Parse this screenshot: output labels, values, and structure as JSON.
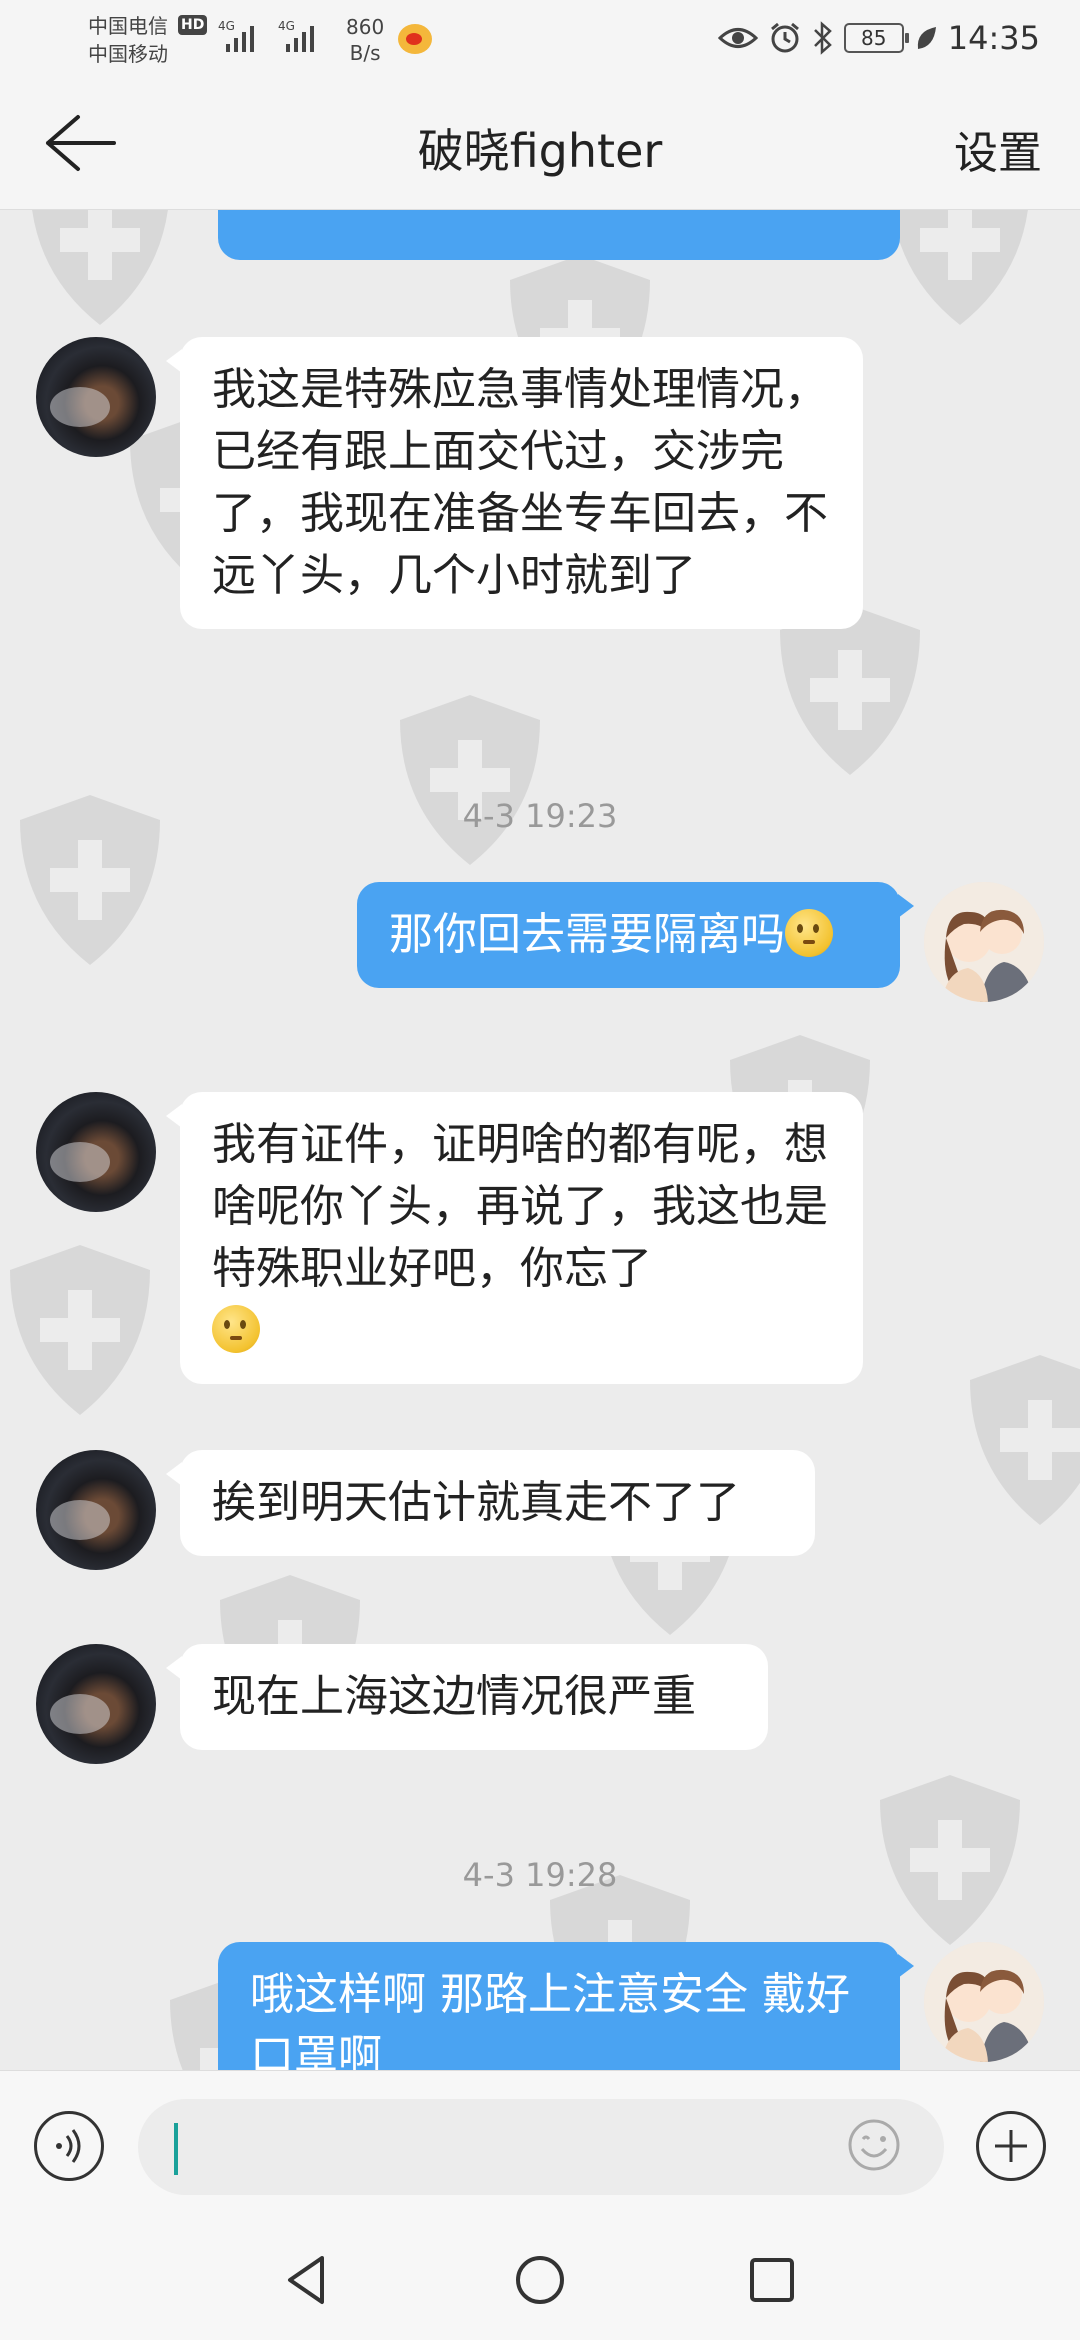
{
  "status_bar": {
    "carrier_1": "中国电信",
    "carrier_2": "中国移动",
    "hd_badge": "HD",
    "signal_1": "4G",
    "signal_2": "4G",
    "net_speed_value": "860",
    "net_speed_unit": "B/s",
    "battery": "85",
    "time": "14:35",
    "icons": [
      "weibo-icon",
      "eye-icon",
      "alarm-icon",
      "bluetooth-icon",
      "battery-icon",
      "leaf-icon"
    ]
  },
  "nav": {
    "title": "破晓fighter",
    "settings_label": "设置",
    "back_icon": "back-arrow-icon"
  },
  "messages": [
    {
      "type": "partial-right"
    },
    {
      "type": "left",
      "text": "我这是特殊应急事情处理情况，已经有跟上面交代过，交涉完了，我现在准备坐专车回去，不远丫头，几个小时就到了"
    },
    {
      "type": "time",
      "text": "4-3 19:23"
    },
    {
      "type": "right",
      "text": "那你回去需要隔离吗",
      "emoji": "thinking-emoji"
    },
    {
      "type": "left",
      "text": "我有证件，证明啥的都有呢，想啥呢你丫头，再说了，我这也是特殊职业好吧，你忘了",
      "emoji": "thinking-emoji"
    },
    {
      "type": "left",
      "text": "挨到明天估计就真走不了了"
    },
    {
      "type": "left",
      "text": "现在上海这边情况很严重"
    },
    {
      "type": "time",
      "text": "4-3 19:28"
    },
    {
      "type": "right",
      "text": "哦这样啊 那路上注意安全 戴好口罩啊"
    }
  ],
  "input_bar": {
    "placeholder": "",
    "voice_icon": "voice-icon",
    "emoji_icon": "emoji-icon",
    "plus_icon": "plus-icon"
  },
  "system_nav": [
    "back-triangle-icon",
    "home-circle-icon",
    "recents-square-icon"
  ],
  "colors": {
    "bubble_right": "#4aa3f2",
    "bubble_left": "#ffffff",
    "background": "#ececec",
    "watermark": "#c9c9c9"
  }
}
